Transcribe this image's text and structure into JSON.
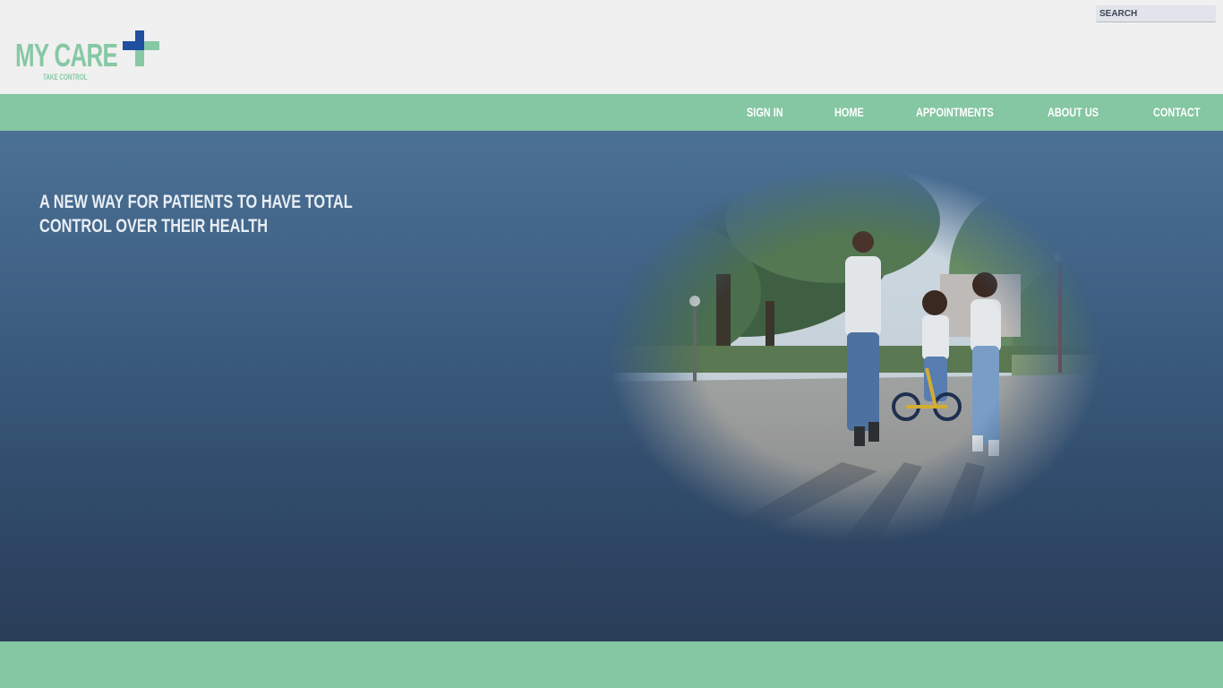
{
  "brand": {
    "name": "MY CARE",
    "tagline": "TAKE CONTROL",
    "primary_color": "#86c8a4",
    "cross_colors": [
      "#1f4f9e",
      "#86c8a4"
    ]
  },
  "search": {
    "placeholder": "SEARCH"
  },
  "nav": {
    "items": [
      {
        "label": "SIGN IN"
      },
      {
        "label": "HOME"
      },
      {
        "label": "APPOINTMENTS"
      },
      {
        "label": "ABOUT US"
      },
      {
        "label": "CONTACT"
      }
    ]
  },
  "hero": {
    "heading": "A NEW WAY FOR PATIENTS TO HAVE TOTAL CONTROL OVER THEIR HEALTH",
    "image": "family-bike-photo"
  },
  "colors": {
    "nav_bg": "#85c6a3",
    "hero_top": "#4b7195",
    "hero_bottom": "#2a3d58",
    "header_bg": "#f0f0f0"
  }
}
